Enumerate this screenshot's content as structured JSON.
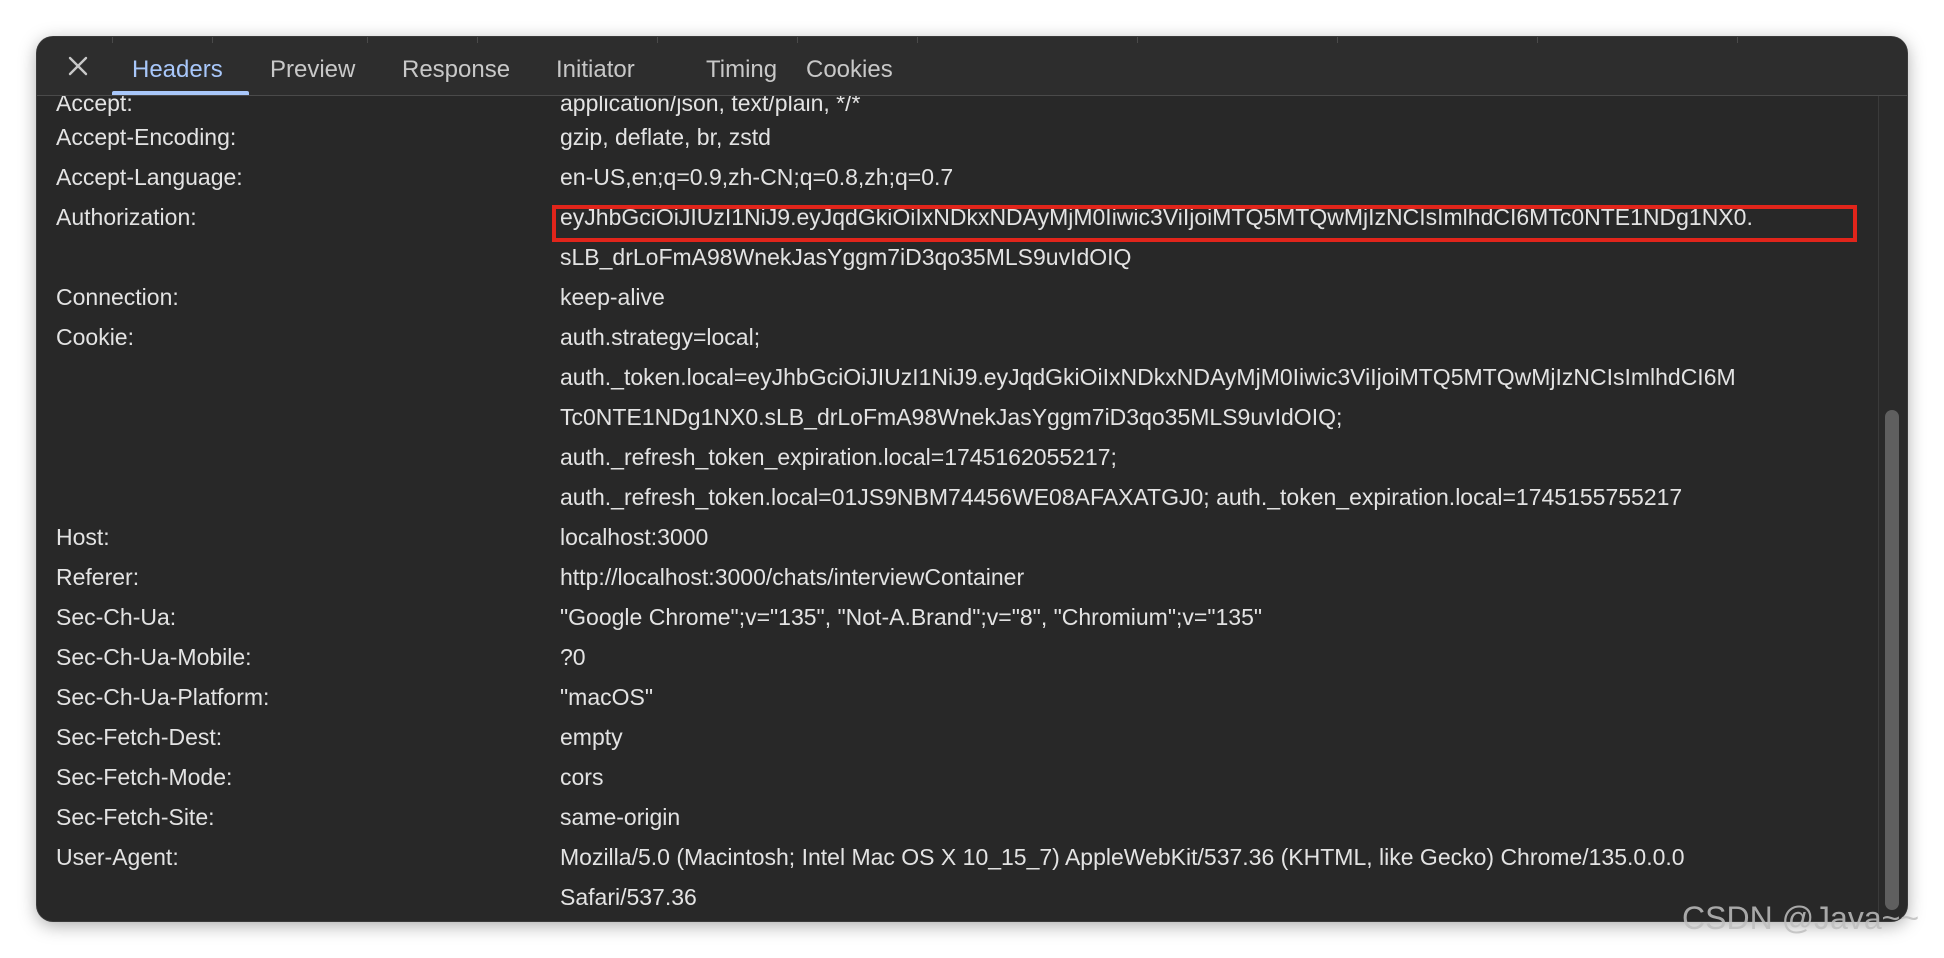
{
  "tabs": [
    {
      "label": "Headers",
      "active": true
    },
    {
      "label": "Preview",
      "active": false
    },
    {
      "label": "Response",
      "active": false
    },
    {
      "label": "Initiator",
      "active": false
    },
    {
      "label": "Timing",
      "active": false
    },
    {
      "label": "Cookies",
      "active": false
    }
  ],
  "close_icon": "close-icon",
  "headers": {
    "accept": {
      "key": "Accept:",
      "value": "application/json, text/plain, */*"
    },
    "accept_encoding": {
      "key": "Accept-Encoding:",
      "value": "gzip, deflate, br, zstd"
    },
    "accept_language": {
      "key": "Accept-Language:",
      "value": "en-US,en;q=0.9,zh-CN;q=0.8,zh;q=0.7"
    },
    "authorization": {
      "key": "Authorization:",
      "value_lines": [
        "eyJhbGciOiJIUzI1NiJ9.eyJqdGkiOiIxNDkxNDAyMjM0Iiwic3ViIjoiMTQ5MTQwMjIzNCIsImlhdCI6MTc0NTE1NDg1NX0.",
        "sLB_drLoFmA98WnekJasYggm7iD3qo35MLS9uvIdOIQ"
      ]
    },
    "connection": {
      "key": "Connection:",
      "value": "keep-alive"
    },
    "cookie": {
      "key": "Cookie:",
      "value_lines": [
        "auth.strategy=local;",
        "auth._token.local=eyJhbGciOiJIUzI1NiJ9.eyJqdGkiOiIxNDkxNDAyMjM0Iiwic3ViIjoiMTQ5MTQwMjIzNCIsImlhdCI6M",
        "Tc0NTE1NDg1NX0.sLB_drLoFmA98WnekJasYggm7iD3qo35MLS9uvIdOIQ;",
        "auth._refresh_token_expiration.local=1745162055217;",
        "auth._refresh_token.local=01JS9NBM74456WE08AFAXATGJ0; auth._token_expiration.local=1745155755217"
      ]
    },
    "host": {
      "key": "Host:",
      "value": "localhost:3000"
    },
    "referer": {
      "key": "Referer:",
      "value": "http://localhost:3000/chats/interviewContainer"
    },
    "sec_ch_ua": {
      "key": "Sec-Ch-Ua:",
      "value": "\"Google Chrome\";v=\"135\", \"Not-A.Brand\";v=\"8\", \"Chromium\";v=\"135\""
    },
    "sec_ch_ua_mobile": {
      "key": "Sec-Ch-Ua-Mobile:",
      "value": "?0"
    },
    "sec_ch_ua_platform": {
      "key": "Sec-Ch-Ua-Platform:",
      "value": "\"macOS\""
    },
    "sec_fetch_dest": {
      "key": "Sec-Fetch-Dest:",
      "value": "empty"
    },
    "sec_fetch_mode": {
      "key": "Sec-Fetch-Mode:",
      "value": "cors"
    },
    "sec_fetch_site": {
      "key": "Sec-Fetch-Site:",
      "value": "same-origin"
    },
    "user_agent": {
      "key": "User-Agent:",
      "value_lines": [
        "Mozilla/5.0 (Macintosh; Intel Mac OS X 10_15_7) AppleWebKit/537.36 (KHTML, like Gecko) Chrome/135.0.0.0",
        "Safari/537.36"
      ]
    }
  },
  "highlight_color": "#e1251b",
  "accent_color": "#a8c7fa",
  "watermark": "CSDN @Java~~"
}
